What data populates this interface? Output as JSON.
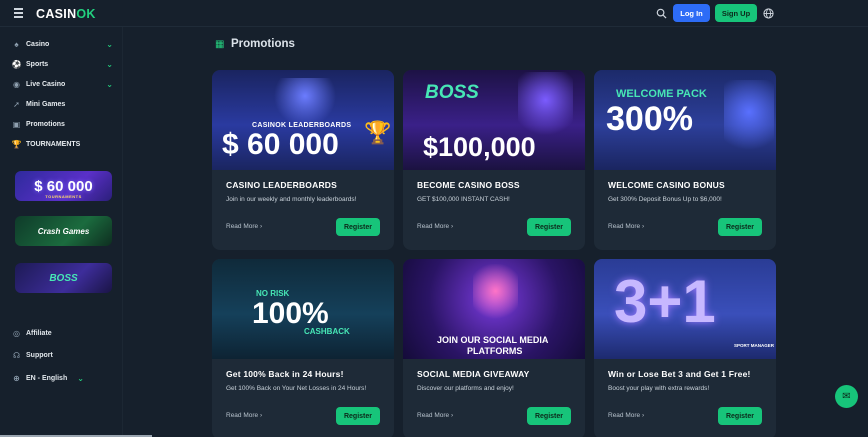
{
  "brand": {
    "logo_a": "CASIN",
    "logo_b": "OK"
  },
  "header": {
    "login_label": "Log In",
    "signup_label": "Sign Up"
  },
  "sidebar": {
    "items": [
      {
        "label": "Casino",
        "icon": "cards-icon",
        "has_chevron": true
      },
      {
        "label": "Sports",
        "icon": "ball-icon",
        "has_chevron": true
      },
      {
        "label": "Live Casino",
        "icon": "live-icon",
        "has_chevron": true
      },
      {
        "label": "Mini Games",
        "icon": "rocket-icon",
        "has_chevron": false
      },
      {
        "label": "Promotions",
        "icon": "gift-icon",
        "has_chevron": false
      },
      {
        "label": "TOURNAMENTS",
        "icon": "trophy-icon",
        "has_chevron": false
      }
    ],
    "banners": [
      {
        "text": "$ 60 000",
        "sub": "TOURNAMENTS"
      },
      {
        "text": "Crash Games"
      },
      {
        "text": "BOSS"
      }
    ],
    "footer": [
      {
        "label": "Affiliate",
        "icon": "affiliate-icon"
      },
      {
        "label": "Support",
        "icon": "headset-icon"
      },
      {
        "label": "EN - English",
        "icon": "globe-icon"
      }
    ]
  },
  "main": {
    "title": "Promotions",
    "cards": [
      {
        "title": "CASINO LEADERBOARDS",
        "desc": "Join in our weekly and monthly leaderboards!",
        "more": "Read More",
        "cta": "Register",
        "img_line1": "CASINOK LEADERBOARDS",
        "img_line2": "$ 60 000"
      },
      {
        "title": "BECOME CASINO BOSS",
        "desc": "GET $100,000 INSTANT CASH!",
        "more": "Read More",
        "cta": "Register",
        "img_line1": "BOSS",
        "img_line2": "$100,000"
      },
      {
        "title": "WELCOME CASINO BONUS",
        "desc": "Get 300% Deposit Bonus Up to $6,000!",
        "more": "Read More",
        "cta": "Register",
        "img_line1": "WELCOME PACK",
        "img_line2": "300%"
      },
      {
        "title": "Get 100% Back in 24 Hours!",
        "desc": "Get 100% Back on Your Net Losses in 24 Hours!",
        "more": "Read More",
        "cta": "Register",
        "img_line1": "NO RISK",
        "img_line2": "100%",
        "img_line3": "CASHBACK"
      },
      {
        "title": "SOCIAL MEDIA GIVEAWAY",
        "desc": "Discover our platforms and enjoy!",
        "more": "Read More",
        "cta": "Register",
        "img_line1": "JOIN OUR SOCIAL MEDIA",
        "img_line2": "PLATFORMS"
      },
      {
        "title": "Win or Lose Bet 3 and Get 1 Free!",
        "desc": "Boost your play with extra rewards!",
        "more": "Read More",
        "cta": "Register",
        "img_line1": "3+1",
        "img_line2": "SPORT MANAGER"
      }
    ]
  },
  "colors": {
    "accent": "#17c47a",
    "login": "#2d6cf6",
    "bg": "#16202c",
    "card": "#1e2a37"
  }
}
